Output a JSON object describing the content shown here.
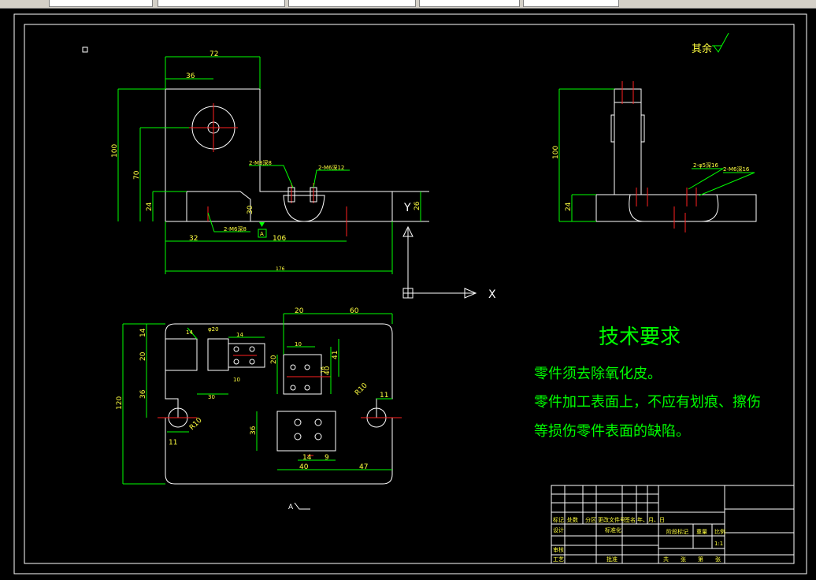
{
  "top_tabs": [
    "",
    "",
    "",
    "",
    ""
  ],
  "roughness_note": "其余",
  "tech_requirements": {
    "title": "技术要求",
    "lines": [
      "零件须去除氧化皮。",
      "零件加工表面上，不应有划痕、擦伤",
      "等损伤零件表面的缺陷。"
    ]
  },
  "front_view_dims": {
    "d72": "72",
    "d36": "36",
    "d100": "100",
    "d70": "70",
    "d24": "24",
    "d30": "30",
    "d32": "32",
    "d106": "106",
    "d176": "176",
    "d26": "26",
    "hole_a": "2-M8深8",
    "hole_b": "2-M6深12",
    "hole_c": "2-M6深8",
    "datum": "A"
  },
  "side_view_dims": {
    "d100": "100",
    "d24": "24",
    "hole_a": "2-φ5深16",
    "hole_b": "2-M6深16"
  },
  "top_view_dims": {
    "d20a": "20",
    "d60": "60",
    "d14a": "14",
    "d14b": "14",
    "d10a": "10",
    "d20b": "20",
    "d40a": "40",
    "d41": "41",
    "d120": "120",
    "d36a": "36",
    "d20c": "20",
    "d30": "30",
    "d10b": "10",
    "d14c": "14",
    "d9": "9",
    "d40b": "40",
    "d47": "47",
    "d11a": "11",
    "d11b": "11",
    "r10a": "R10",
    "r10b": "R10",
    "phi20": "φ20",
    "d36b": "36",
    "d16": "16"
  },
  "ucs": {
    "x_label": "X",
    "y_label": "Y"
  },
  "title_block": {
    "row1": [
      "标记",
      "处数",
      "分区",
      "更改文件号",
      "签名",
      "年、月、日"
    ],
    "row2": [
      "设计",
      "",
      "标准化",
      ""
    ],
    "row3": [
      "审核",
      ""
    ],
    "row4": [
      "工艺",
      "",
      "批准",
      ""
    ],
    "stage_labels": [
      "阶段标记",
      "重量",
      "比例"
    ],
    "scale": "1:1",
    "footer": [
      "共",
      "张",
      "第",
      "张"
    ]
  }
}
